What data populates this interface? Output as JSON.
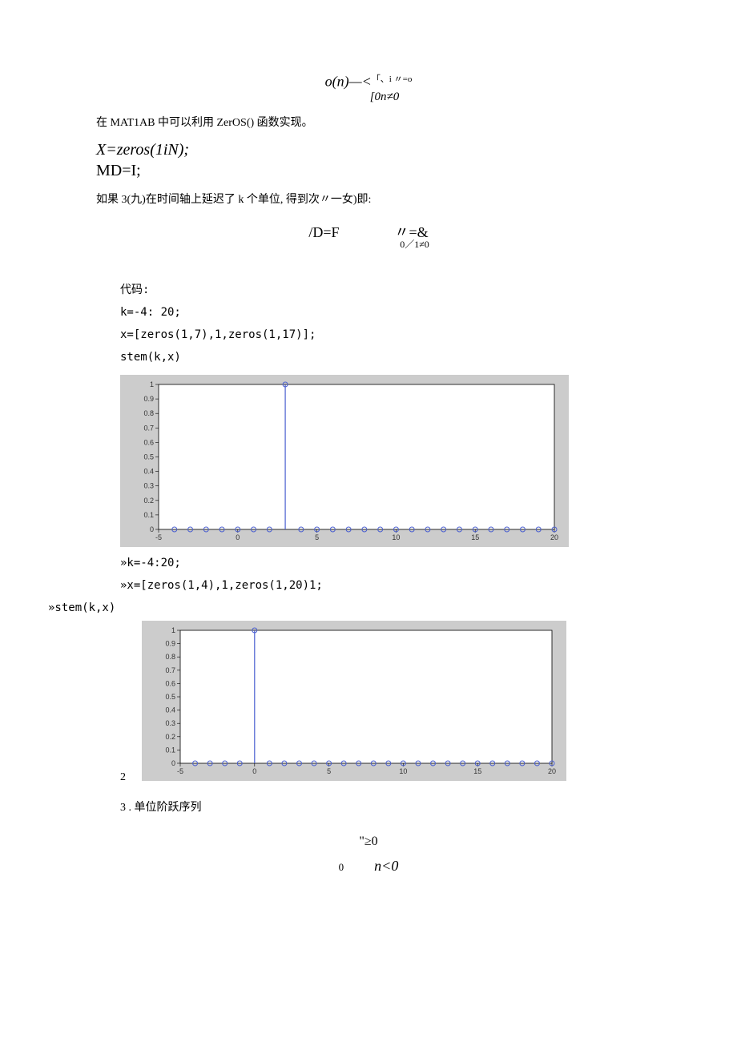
{
  "formula1": {
    "left": "o(n)—<",
    "sup": "「、i 〃=o",
    "bottom": "[0n≠0"
  },
  "para1": "在 MAT1AB 中可以利用 ZerOS() 函数实现。",
  "code_italic_1": "X=zeros(1iN);",
  "code_italic_2": "MD=I;",
  "para2": "如果 3(九)在时间轴上延迟了 k 个单位, 得到次〃一女)即:",
  "formula2": {
    "left": "/D=F",
    "right": "〃=&",
    "sub": "0／1≠0"
  },
  "code_label": "代码:",
  "code_lines": [
    "k=-4: 20;",
    "x=[zeros(1,7),1,zeros(1,17)];",
    "stem(k,x)"
  ],
  "cmd1": "»k=-4:20;",
  "cmd2": "»x=[zeros(1,4),1,zeros(1,20)1;",
  "cmd3": "»stem(k,x)",
  "num2": "2",
  "heading3": "3   . 单位阶跃序列",
  "formula3": {
    "top": "\"≥0",
    "bottom_left": "0",
    "bottom_right": "n<0"
  },
  "chart_data": [
    {
      "type": "stem",
      "xlim": [
        -5,
        20
      ],
      "ylim": [
        0,
        1
      ],
      "xticks": [
        -5,
        0,
        5,
        10,
        15,
        20
      ],
      "yticks": [
        0,
        0.1,
        0.2,
        0.3,
        0.4,
        0.5,
        0.6,
        0.7,
        0.8,
        0.9,
        1
      ],
      "impulse_at": 3,
      "x_range": [
        -4,
        20
      ]
    },
    {
      "type": "stem",
      "xlim": [
        -5,
        20
      ],
      "ylim": [
        0,
        1
      ],
      "xticks": [
        -5,
        0,
        5,
        10,
        15,
        20
      ],
      "yticks": [
        0,
        0.1,
        0.2,
        0.3,
        0.4,
        0.5,
        0.6,
        0.7,
        0.8,
        0.9,
        1
      ],
      "impulse_at": 0,
      "x_range": [
        -4,
        20
      ]
    }
  ]
}
